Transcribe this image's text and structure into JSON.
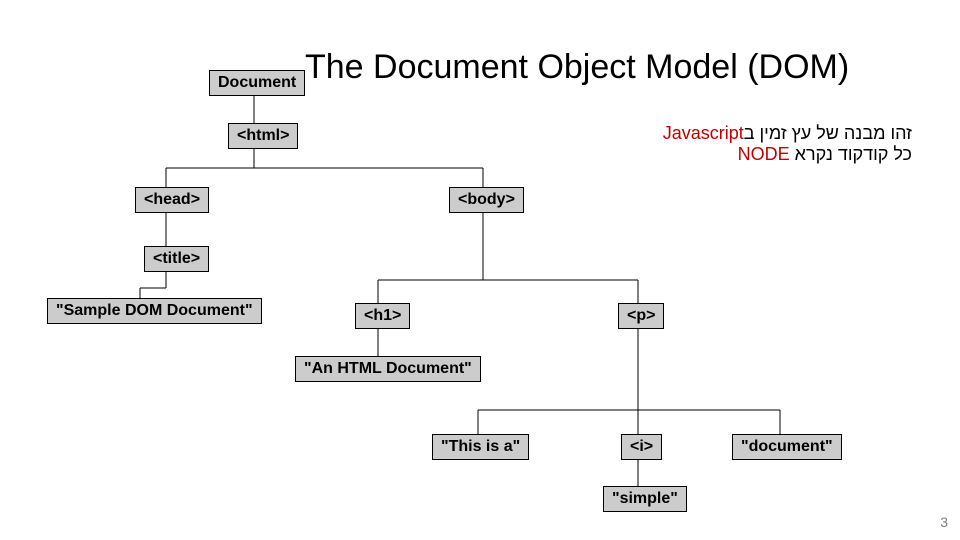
{
  "title": "The Document Object Model (DOM)",
  "nodes": {
    "document": "Document",
    "html": "<html>",
    "head": "<head>",
    "body": "<body>",
    "title_tag": "<title>",
    "sample_text": "\"Sample DOM Document\"",
    "h1": "<h1>",
    "p": "<p>",
    "an_html_doc": "\"An HTML Document\"",
    "this_is_a": "\"This is a\"",
    "i": "<i>",
    "document_text": "\"document\"",
    "simple": "\"simple\""
  },
  "caption": {
    "line1_prefix": "זהו מבנה של עץ זמין ב",
    "line1_hl": "Javascript",
    "line2_prefix": "כל קודקוד נקרא ",
    "line2_hl": "NODE"
  },
  "slide_number": "3"
}
